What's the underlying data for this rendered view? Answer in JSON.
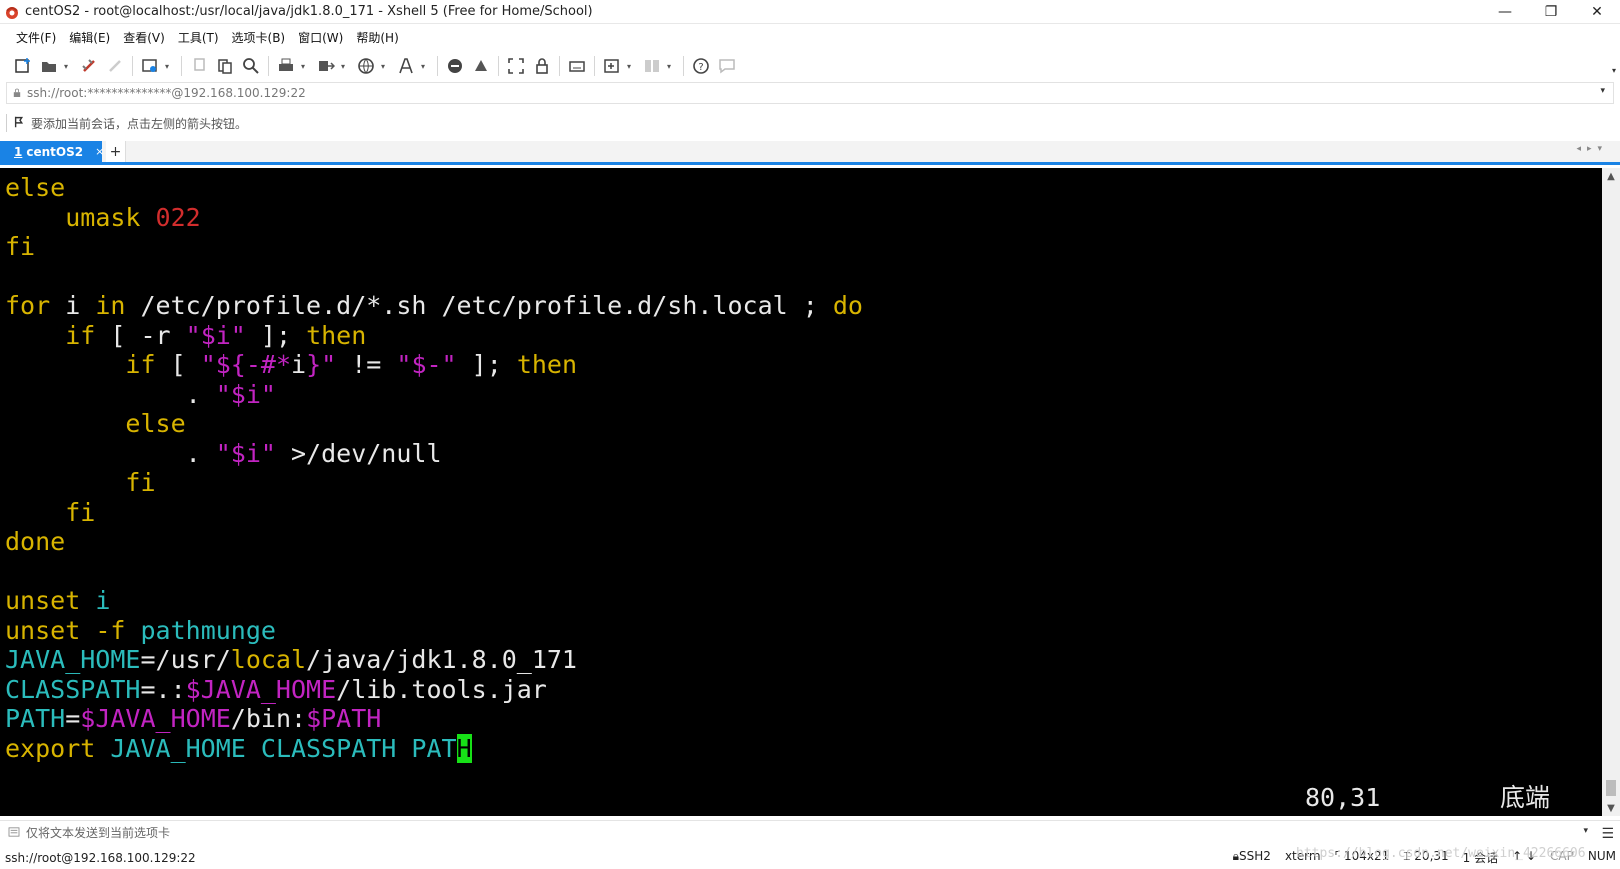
{
  "window": {
    "title": "centOS2 - root@localhost:/usr/local/java/jdk1.8.0_171 - Xshell 5 (Free for Home/School)",
    "controls": [
      "—",
      "❐",
      "✕"
    ]
  },
  "menubar": {
    "items": [
      "文件(F)",
      "编辑(E)",
      "查看(V)",
      "工具(T)",
      "选项卡(B)",
      "窗口(W)",
      "帮助(H)"
    ]
  },
  "toolbar": {
    "icons": [
      "new-session-icon",
      "open-icon",
      "reconnect-icon",
      "disconnect-icon",
      "properties-icon",
      "copy-icon",
      "paste-icon",
      "find-icon",
      "print-icon",
      "transfer-icon",
      "globe-icon",
      "font-icon",
      "xftp-icon",
      "xagent-icon",
      "fullscreen-icon",
      "lock-icon",
      "keyboard-icon",
      "compose-icon",
      "layout-icon",
      "help-icon",
      "chat-icon"
    ]
  },
  "address": {
    "value": "ssh://root:**************@192.168.100.129:22"
  },
  "hint": {
    "text": "要添加当前会话，点击左侧的箭头按钮。"
  },
  "tabs": [
    {
      "number": "1",
      "label": "centOS2",
      "close": "×",
      "active": true
    }
  ],
  "new_tab": "+",
  "terminal": {
    "lines": [
      [
        [
          "y",
          "else"
        ]
      ],
      [
        [
          "w",
          "    "
        ],
        [
          "y",
          "umask "
        ],
        [
          "r",
          "022"
        ]
      ],
      [
        [
          "y",
          "fi"
        ]
      ],
      [
        [
          "w",
          ""
        ]
      ],
      [
        [
          "y",
          "for"
        ],
        [
          "w",
          " i "
        ],
        [
          "y",
          "in"
        ],
        [
          "w",
          " /etc/profile.d/*.sh /etc/profile.d/sh.local ; "
        ],
        [
          "y",
          "do"
        ]
      ],
      [
        [
          "w",
          "    "
        ],
        [
          "y",
          "if"
        ],
        [
          "w",
          " [ -r "
        ],
        [
          "m",
          "\"$i\""
        ],
        [
          "w",
          " ]; "
        ],
        [
          "y",
          "then"
        ]
      ],
      [
        [
          "w",
          "        "
        ],
        [
          "y",
          "if"
        ],
        [
          "w",
          " [ "
        ],
        [
          "m",
          "\"${-#*"
        ],
        [
          "w",
          "i"
        ],
        [
          "m",
          "}\""
        ],
        [
          "w",
          " != "
        ],
        [
          "m",
          "\"$-\""
        ],
        [
          "w",
          " ]; "
        ],
        [
          "y",
          "then"
        ]
      ],
      [
        [
          "w",
          "            . "
        ],
        [
          "m",
          "\"$i\""
        ]
      ],
      [
        [
          "w",
          "        "
        ],
        [
          "y",
          "else"
        ]
      ],
      [
        [
          "w",
          "            . "
        ],
        [
          "m",
          "\"$i\""
        ],
        [
          "w",
          " >/dev/null"
        ]
      ],
      [
        [
          "w",
          "        "
        ],
        [
          "y",
          "fi"
        ]
      ],
      [
        [
          "w",
          "    "
        ],
        [
          "y",
          "fi"
        ]
      ],
      [
        [
          "y",
          "done"
        ]
      ],
      [
        [
          "w",
          ""
        ]
      ],
      [
        [
          "y",
          "unset"
        ],
        [
          "w",
          " "
        ],
        [
          "c",
          "i"
        ]
      ],
      [
        [
          "y",
          "unset"
        ],
        [
          "w",
          " "
        ],
        [
          "y",
          "-f"
        ],
        [
          "w",
          " "
        ],
        [
          "c",
          "pathmunge"
        ]
      ],
      [
        [
          "c",
          "JAVA_HOME"
        ],
        [
          "w",
          "=/usr/"
        ],
        [
          "y",
          "local"
        ],
        [
          "w",
          "/java/jdk1.8.0_171"
        ]
      ],
      [
        [
          "c",
          "CLASSPATH"
        ],
        [
          "w",
          "=.:"
        ],
        [
          "m",
          "$JAVA_HOME"
        ],
        [
          "w",
          "/lib.tools.jar"
        ]
      ],
      [
        [
          "c",
          "PATH"
        ],
        [
          "w",
          "="
        ],
        [
          "m",
          "$JAVA_HOME"
        ],
        [
          "w",
          "/bin:"
        ],
        [
          "m",
          "$PATH"
        ]
      ],
      [
        [
          "y",
          "export"
        ],
        [
          "w",
          " "
        ],
        [
          "c",
          "JAVA_HOME CLASSPATH PAT"
        ],
        [
          "cur",
          "H"
        ]
      ]
    ],
    "cursor_position": "80,31",
    "scroll_status": "底端"
  },
  "sendbar": {
    "text": "仅将文本发送到当前选项卡"
  },
  "statusbar": {
    "connection": "ssh://root@192.168.100.129:22",
    "protocol": "SSH2",
    "terminal_type": "xterm",
    "size": "104x21",
    "position": "20,31",
    "sessions": "1 会话",
    "cap": "CAP",
    "num": "NUM",
    "watermark": "https://blog.csdn.net/weixin_42266606"
  },
  "colors": {
    "accent": "#1a83e5",
    "terminal_bg": "#000000",
    "keyword_yellow": "#d8b400",
    "string_magenta": "#c224c2",
    "variable_cyan": "#2bbcbc",
    "number_red": "#d22d2d",
    "cursor_green": "#17e117"
  }
}
